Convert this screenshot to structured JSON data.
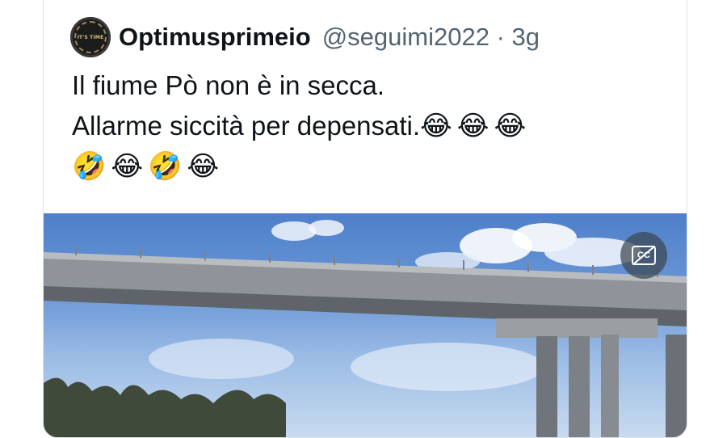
{
  "tweet": {
    "display_name": "Optimusprimeio",
    "handle_time": "@seguimi2022 · 3g",
    "text_line1": "Il fiume Pò non è in secca.",
    "text_line2": "Allarme siccità per depensati.",
    "emojis_line2": "😂😂😂",
    "emojis_line3": "🤣😂🤣😂"
  },
  "avatar": {
    "text": "IT'S TIME"
  },
  "video": {
    "cc_label": "CC",
    "subject": "bridge-over-river"
  },
  "colors": {
    "text": "#0f1419",
    "secondary": "#536471",
    "border": "#dfe3e8",
    "sky": "#6a97d6"
  }
}
